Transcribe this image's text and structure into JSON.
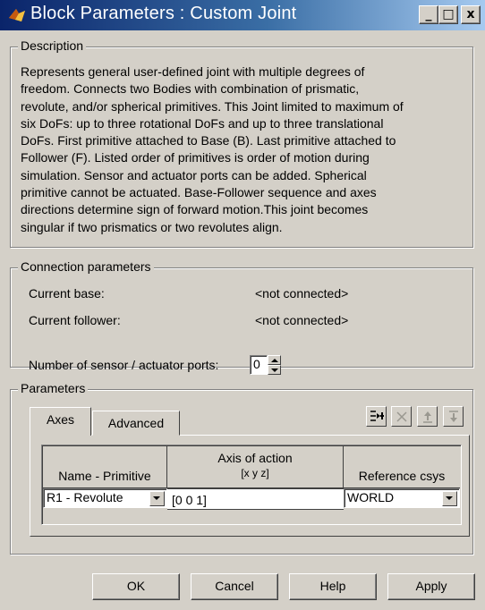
{
  "window": {
    "title": "Block Parameters : Custom Joint",
    "minimize": "_",
    "maximize": "□",
    "close": "x"
  },
  "description": {
    "legend": "Description",
    "lines": [
      "Represents general user-defined joint with multiple degrees of",
      "freedom. Connects two Bodies with combination of prismatic,",
      "revolute, and/or spherical primitives. This Joint limited to maximum of",
      "six DoFs: up to three rotational DoFs and up to three translational",
      "DoFs. First primitive attached to Base (B). Last primitive attached to",
      "Follower (F). Listed order of primitives is order of motion during",
      "simulation. Sensor and actuator ports can be added. Spherical",
      "primitive cannot be actuated. Base-Follower sequence and axes",
      "directions determine sign of forward motion.This joint becomes",
      "singular if two prismatics or two revolutes align."
    ]
  },
  "connection": {
    "legend": "Connection parameters",
    "current_base_label": "Current base:",
    "current_base_value": "<not connected>",
    "current_follower_label": "Current follower:",
    "current_follower_value": "<not connected>",
    "ports_label": "Number of sensor / actuator ports:",
    "ports_value": "0"
  },
  "parameters": {
    "legend": "Parameters",
    "tabs": [
      {
        "label": "Axes",
        "active": true
      },
      {
        "label": "Advanced",
        "active": false
      }
    ],
    "toolbar_icons": [
      "insert-row-icon",
      "delete-row-icon",
      "move-up-icon",
      "move-down-icon"
    ],
    "table": {
      "headers": {
        "name": "Name - Primitive",
        "axis_line1": "Axis of action",
        "axis_line2": "[x y z]",
        "ref": "Reference csys"
      },
      "rows": [
        {
          "name": "R1 - Revolute",
          "axis": "[0 0 1]",
          "ref": "WORLD"
        }
      ]
    }
  },
  "buttons": {
    "ok": "OK",
    "cancel": "Cancel",
    "help": "Help",
    "apply": "Apply"
  }
}
